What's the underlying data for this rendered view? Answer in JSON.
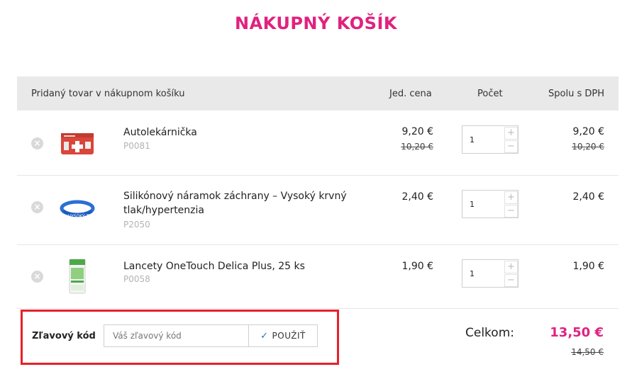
{
  "title": "NÁKUPNÝ KOŠÍK",
  "header": {
    "product": "Pridaný tovar v nákupnom košíku",
    "unit_price": "Jed. cena",
    "quantity": "Počet",
    "total": "Spolu s DPH"
  },
  "items": [
    {
      "name": "Autolekárnička",
      "code": "P0081",
      "unit_price": "9,20 €",
      "old_unit_price": "10,20 €",
      "quantity": "1",
      "total": "9,20 €",
      "old_total": "10,20 €",
      "thumb": "first-aid-kit"
    },
    {
      "name_line1": "Silikónový náramok záchrany – Vysoký krvný",
      "name_line2": "tlak/hypertenzia",
      "code": "P2050",
      "unit_price": "2,40 €",
      "quantity": "1",
      "total": "2,40 €",
      "thumb": "silicone-bracelet"
    },
    {
      "name": "Lancety OneTouch Delica Plus, 25 ks",
      "code": "P0058",
      "unit_price": "1,90 €",
      "quantity": "1",
      "total": "1,90 €",
      "thumb": "lancet-box"
    }
  ],
  "discount": {
    "label": "Zľavový kód",
    "placeholder": "Váš zľavový kód",
    "button": "POUŽIŤ"
  },
  "summary": {
    "label": "Celkom:",
    "total": "13,50 €",
    "old_total": "14,50 €"
  },
  "controls": {
    "remove": "×",
    "plus": "+",
    "minus": "−",
    "check": "✓"
  },
  "colors": {
    "accent": "#e0227f",
    "highlight_frame": "#e8202a"
  }
}
